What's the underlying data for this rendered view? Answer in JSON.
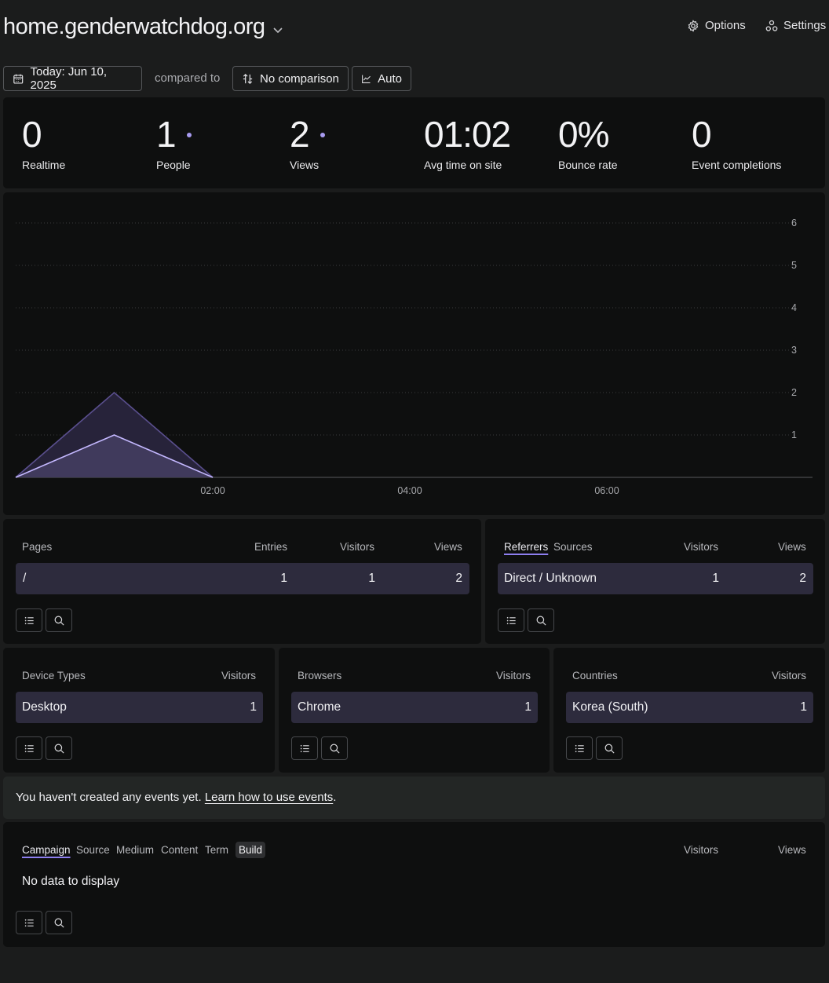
{
  "header": {
    "site": "home.genderwatchdog.org",
    "options_label": "Options",
    "settings_label": "Settings"
  },
  "toolbar": {
    "date_label": "Today: Jun 10, 2025",
    "compared_to": "compared to",
    "comparison_label": "No comparison",
    "interval_label": "Auto"
  },
  "stats": [
    {
      "value": "0",
      "label": "Realtime",
      "dot": false
    },
    {
      "value": "1",
      "label": "People",
      "dot": true
    },
    {
      "value": "2",
      "label": "Views",
      "dot": true
    },
    {
      "value": "01:02",
      "label": "Avg time on site",
      "dot": false
    },
    {
      "value": "0%",
      "label": "Bounce rate",
      "dot": false
    },
    {
      "value": "0",
      "label": "Event completions",
      "dot": false
    }
  ],
  "colors": {
    "accent": "#a89bf0",
    "views_fill": "#27233a",
    "views_line": "#5a4f8e",
    "people_fill": "#403a5c",
    "people_line": "#c4b8ff",
    "row_bg": "#2d2b3d"
  },
  "chart_data": {
    "type": "area",
    "x": [
      "00:00",
      "01:00",
      "02:00",
      "03:00",
      "04:00",
      "05:00",
      "06:00",
      "07:00"
    ],
    "x_tick_labels": [
      "02:00",
      "04:00",
      "06:00"
    ],
    "ylim": [
      0,
      6
    ],
    "y_ticks": [
      1,
      2,
      3,
      4,
      5,
      6
    ],
    "series": [
      {
        "values": [
          0,
          2,
          0,
          0,
          0,
          0,
          0,
          0
        ]
      },
      {
        "values": [
          0,
          1,
          0,
          0,
          0,
          0,
          0,
          0
        ]
      }
    ]
  },
  "pages": {
    "title": "Pages",
    "cols": [
      "Entries",
      "Visitors",
      "Views"
    ],
    "rows": [
      {
        "label": "/",
        "entries": "1",
        "visitors": "1",
        "views": "2"
      }
    ]
  },
  "referrers": {
    "tab_active": "Referrers",
    "tab_other": "Sources",
    "cols": [
      "Visitors",
      "Views"
    ],
    "rows": [
      {
        "label": "Direct / Unknown",
        "visitors": "1",
        "views": "2"
      }
    ]
  },
  "devices": {
    "title": "Device Types",
    "col": "Visitors",
    "rows": [
      {
        "label": "Desktop",
        "visitors": "1"
      }
    ]
  },
  "browsers": {
    "title": "Browsers",
    "col": "Visitors",
    "rows": [
      {
        "label": "Chrome",
        "visitors": "1"
      }
    ]
  },
  "countries": {
    "title": "Countries",
    "col": "Visitors",
    "rows": [
      {
        "label": "Korea (South)",
        "visitors": "1"
      }
    ]
  },
  "events_notice": {
    "text": "You haven't created any events yet. ",
    "link": "Learn how to use events",
    "end": "."
  },
  "campaign": {
    "tabs": [
      "Campaign",
      "Source",
      "Medium",
      "Content",
      "Term",
      "Build"
    ],
    "cols": [
      "Visitors",
      "Views"
    ],
    "empty": "No data to display"
  },
  "icons": {
    "calendar": "calendar-icon",
    "compare": "compare-arrows-icon",
    "interval": "line-chart-icon",
    "options": "gear-icon",
    "settings": "nodes-icon",
    "list": "list-icon",
    "search": "search-icon"
  }
}
